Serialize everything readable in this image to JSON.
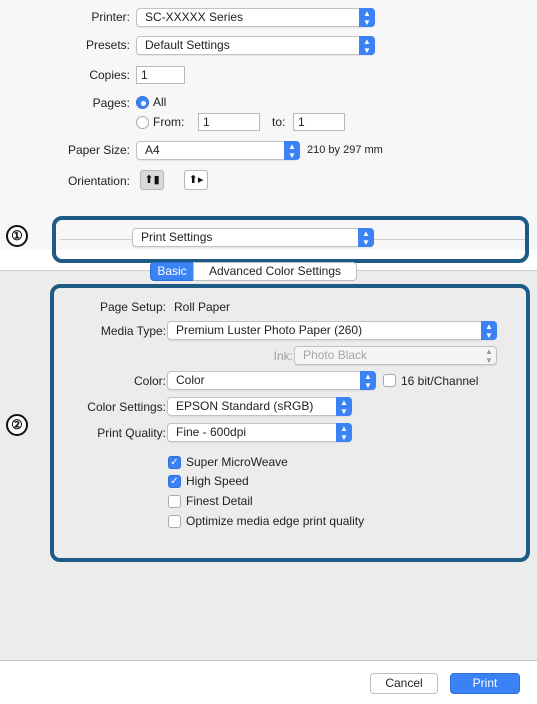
{
  "upper": {
    "printer": {
      "label": "Printer:",
      "value": "SC-XXXXX Series"
    },
    "presets": {
      "label": "Presets:",
      "value": "Default Settings"
    },
    "copies": {
      "label": "Copies:",
      "value": "1"
    },
    "pages": {
      "label": "Pages:",
      "all_label": "All",
      "from_label": "From:",
      "from_value": "1",
      "to_label": "to:",
      "to_value": "1"
    },
    "paper_size": {
      "label": "Paper Size:",
      "value": "A4",
      "dims": "210 by 297 mm"
    },
    "orientation": {
      "label": "Orientation:",
      "portrait_glyph": "⬆▮",
      "landscape_glyph": "⬆▸"
    }
  },
  "panel_menu": {
    "value": "Print Settings"
  },
  "tabs": {
    "basic": "Basic",
    "advanced": "Advanced Color Settings"
  },
  "basic": {
    "page_setup": {
      "label": "Page Setup:",
      "value": "Roll Paper"
    },
    "media_type": {
      "label": "Media Type:",
      "value": "Premium Luster Photo Paper (260)"
    },
    "ink": {
      "label": "Ink:",
      "value": "Photo Black"
    },
    "color": {
      "label": "Color:",
      "value": "Color",
      "checkbox_label": "16 bit/Channel"
    },
    "color_settings": {
      "label": "Color Settings:",
      "value": "EPSON Standard (sRGB)"
    },
    "print_quality": {
      "label": "Print Quality:",
      "value": "Fine - 600dpi"
    },
    "options": [
      {
        "label": "Super MicroWeave",
        "checked": true
      },
      {
        "label": "High Speed",
        "checked": true
      },
      {
        "label": "Finest Detail",
        "checked": false
      },
      {
        "label": "Optimize media edge print quality",
        "checked": false
      }
    ]
  },
  "markers": {
    "one": "①",
    "two": "②"
  },
  "footer": {
    "cancel": "Cancel",
    "print": "Print"
  },
  "icons": {
    "popup_arrows": "chevron-updown-icon",
    "check": "checkmark-icon"
  },
  "colors": {
    "accent": "#3b82f6",
    "callout": "#1d5a86"
  }
}
